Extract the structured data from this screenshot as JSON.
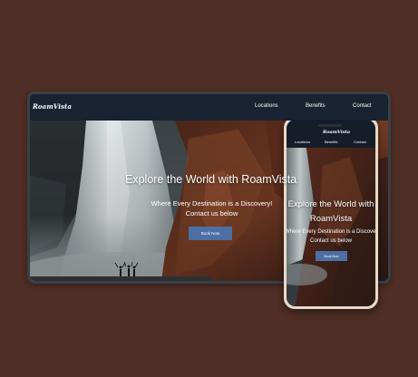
{
  "brand": "RoamVista",
  "nav": {
    "links": [
      "Locations",
      "Benefits",
      "Contact"
    ]
  },
  "hero": {
    "title": "Explore the World with RoamVista",
    "title_line1": "Explore the World with",
    "title_line2": "RoamVista",
    "subtitle_line1": "Where Every Destination is a Discovery!",
    "subtitle_line2": "Contact us below",
    "button": "Book Now"
  },
  "colors": {
    "background": "#4e2e25",
    "nav": "#182230",
    "button": "#4d6fa3",
    "phone_frame": "#e9d9c8"
  },
  "icons": [
    "waterfall-hero-image",
    "phone-notch"
  ]
}
